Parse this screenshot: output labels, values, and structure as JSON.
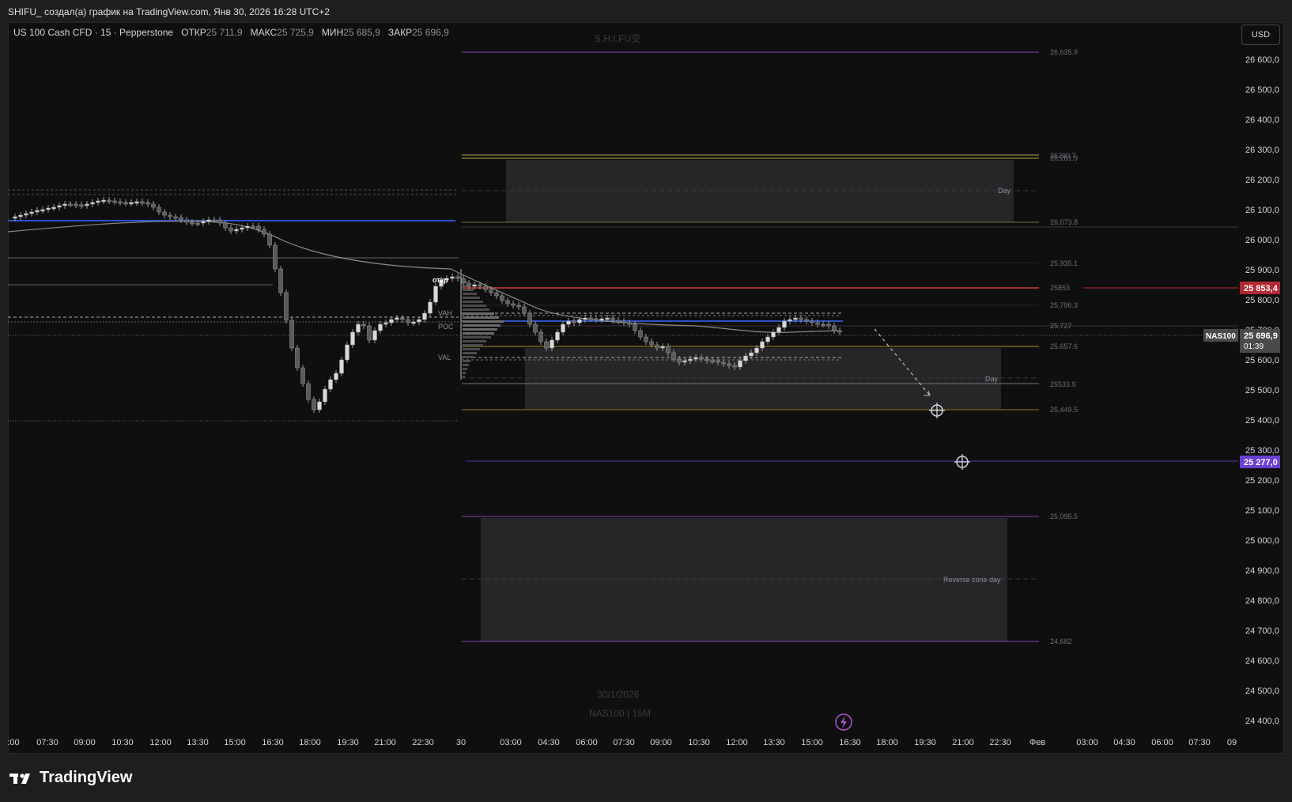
{
  "window": {
    "title": "SHIFU_ создал(а) график на TradingView.com, Янв 30, 2026 16:28 UTC+2"
  },
  "legend": {
    "symbol": "US 100 Cash CFD · 15 · Pepperstone",
    "open_label": "ОТКР",
    "open_value": "25 711,9",
    "high_label": "МАКС",
    "high_value": "25 725,9",
    "low_label": "МИН",
    "low_value": "25 685,9",
    "close_label": "ЗАКР",
    "close_value": "25 696,9"
  },
  "currency": "USD",
  "watermark": {
    "name": "S.H.I.FU交",
    "date": "30/1/2026",
    "symbol": "NAS100 | 15M"
  },
  "price_axis": {
    "ticks": [
      "26 600,0",
      "26 500,0",
      "26 400,0",
      "26 300,0",
      "26 200,0",
      "26 100,0",
      "26 000,0",
      "25 900,0",
      "25 800,0",
      "25 700,0",
      "25 600,0",
      "25 500,0",
      "25 400,0",
      "25 300,0",
      "25 200,0",
      "25 100,0",
      "25 000,0",
      "24 900,0",
      "24 800,0",
      "24 700,0",
      "24 600,0",
      "24 500,0",
      "24 400,0"
    ],
    "red_label": "25 853,4",
    "current_label": "25 696,9",
    "current_timer": "01:39",
    "current_symbol": "NAS100",
    "purple_label": "25 277,0",
    "colors": {
      "red": "#b22833",
      "current": "#4a4a4a",
      "purple": "#6a3fd1"
    }
  },
  "time_axis": {
    "ticks": [
      ":00",
      "07:30",
      "09:00",
      "10:30",
      "12:00",
      "13:30",
      "15:00",
      "16:30",
      "18:00",
      "19:30",
      "21:00",
      "22:30",
      "30",
      "03:00",
      "04:30",
      "06:00",
      "07:30",
      "09:00",
      "10:30",
      "12:00",
      "13:30",
      "15:00",
      "16:30",
      "18:00",
      "19:30",
      "21:00",
      "22:30",
      "Фев",
      "03:00",
      "04:30",
      "06:00",
      "07:30",
      "09"
    ]
  },
  "level_labels": {
    "l26635": "26,635.9",
    "l26290": "26290.7",
    "l26281": "26,281.9",
    "l26073": "26,073.8",
    "l25935": "25,935.1",
    "l25853": "25853",
    "l25796": "25,796.3",
    "l25727": "25,727",
    "l25657": "25,657.6",
    "l25533": "25533.9",
    "l25449": "25,449.5",
    "l25095": "25,095.5",
    "l24682": "24,682"
  },
  "zone_labels": {
    "day_top": "Day",
    "day_mid": "Day",
    "reverse": "Reverse zone day"
  },
  "profile_labels": {
    "vah": "VAH",
    "poc": "POC",
    "val": "VAL",
    "open": "откр"
  },
  "footer": {
    "brand": "TradingView"
  }
}
